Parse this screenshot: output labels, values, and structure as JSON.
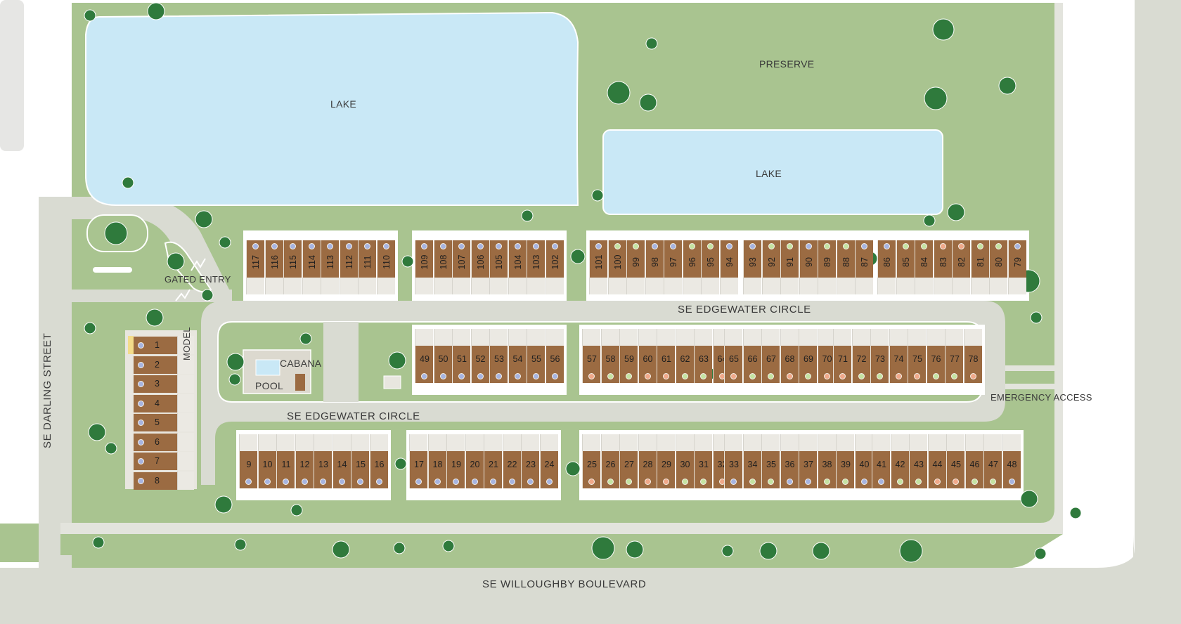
{
  "labels": {
    "lake_1": "LAKE",
    "lake_2": "LAKE",
    "preserve": "PRESERVE",
    "gated_entry": "GATED ENTRY",
    "model": "MODEL",
    "cabana": "CABANA",
    "pool": "POOL",
    "road_edgewater_north": "SE EDGEWATER CIRCLE",
    "road_edgewater_south": "SE EDGEWATER CIRCLE",
    "road_darling": "SE DARLING STREET",
    "road_willoughby": "SE WILLOUGHBY BOULEVARD",
    "emergency_access": "EMERGENCY ACCESS"
  },
  "colors": {
    "grass": "#a9c490",
    "grass_light": "#b7cf9f",
    "water": "#c9e8f6",
    "road": "#d9dbd2",
    "lot": "#9b6b42",
    "tree": "#2f7a3c",
    "dot_blue": "#a7b4e0",
    "dot_green": "#c5e3a2",
    "dot_salmon": "#f0a98a",
    "model_highlight": "#f3dc8a"
  },
  "lot_rows": [
    {
      "id": "row-north-1",
      "orientation": "top",
      "lots": [
        {
          "n": "117",
          "c": "blue"
        },
        {
          "n": "116",
          "c": "blue"
        },
        {
          "n": "115",
          "c": "blue"
        },
        {
          "n": "114",
          "c": "blue"
        },
        {
          "n": "113",
          "c": "blue"
        },
        {
          "n": "112",
          "c": "blue"
        },
        {
          "n": "111",
          "c": "blue"
        },
        {
          "n": "110",
          "c": "blue"
        }
      ]
    },
    {
      "id": "row-north-2",
      "orientation": "top",
      "lots": [
        {
          "n": "109",
          "c": "blue"
        },
        {
          "n": "108",
          "c": "blue"
        },
        {
          "n": "107",
          "c": "blue"
        },
        {
          "n": "106",
          "c": "blue"
        },
        {
          "n": "105",
          "c": "blue"
        },
        {
          "n": "104",
          "c": "blue"
        },
        {
          "n": "103",
          "c": "blue"
        },
        {
          "n": "102",
          "c": "blue"
        }
      ]
    },
    {
      "id": "row-north-3",
      "orientation": "top",
      "lots": [
        {
          "n": "101",
          "c": "blue"
        },
        {
          "n": "100",
          "c": "green"
        },
        {
          "n": "99",
          "c": "green"
        },
        {
          "n": "98",
          "c": "blue"
        },
        {
          "n": "97",
          "c": "blue"
        },
        {
          "n": "96",
          "c": "green"
        },
        {
          "n": "95",
          "c": "green"
        },
        {
          "n": "94",
          "c": "blue"
        }
      ]
    },
    {
      "id": "row-north-4",
      "orientation": "top",
      "lots": [
        {
          "n": "93",
          "c": "blue"
        },
        {
          "n": "92",
          "c": "green"
        },
        {
          "n": "91",
          "c": "green"
        },
        {
          "n": "90",
          "c": "blue"
        },
        {
          "n": "89",
          "c": "green"
        },
        {
          "n": "88",
          "c": "green"
        },
        {
          "n": "87",
          "c": "blue"
        }
      ]
    },
    {
      "id": "row-north-5",
      "orientation": "top",
      "lots": [
        {
          "n": "86",
          "c": "blue"
        },
        {
          "n": "85",
          "c": "green"
        },
        {
          "n": "84",
          "c": "green"
        },
        {
          "n": "83",
          "c": "salmon"
        },
        {
          "n": "82",
          "c": "salmon"
        },
        {
          "n": "81",
          "c": "green"
        },
        {
          "n": "80",
          "c": "green"
        },
        {
          "n": "79",
          "c": "blue"
        }
      ]
    },
    {
      "id": "row-middle-1",
      "orientation": "bot",
      "lots": [
        {
          "n": "49",
          "c": "blue"
        },
        {
          "n": "50",
          "c": "blue"
        },
        {
          "n": "51",
          "c": "blue"
        },
        {
          "n": "52",
          "c": "blue"
        },
        {
          "n": "53",
          "c": "blue"
        },
        {
          "n": "54",
          "c": "blue"
        },
        {
          "n": "55",
          "c": "blue"
        },
        {
          "n": "56",
          "c": "blue"
        }
      ]
    },
    {
      "id": "row-middle-2",
      "orientation": "bot",
      "lots": [
        {
          "n": "57",
          "c": "salmon"
        },
        {
          "n": "58",
          "c": "green"
        },
        {
          "n": "59",
          "c": "green"
        },
        {
          "n": "60",
          "c": "salmon"
        },
        {
          "n": "61",
          "c": "salmon"
        },
        {
          "n": "62",
          "c": "green"
        },
        {
          "n": "63",
          "c": "green"
        },
        {
          "n": "64",
          "c": "salmon"
        }
      ]
    },
    {
      "id": "row-middle-3",
      "orientation": "bot",
      "lots": [
        {
          "n": "65",
          "c": "salmon"
        },
        {
          "n": "66",
          "c": "green"
        },
        {
          "n": "67",
          "c": "green"
        },
        {
          "n": "68",
          "c": "salmon"
        },
        {
          "n": "69",
          "c": "green"
        },
        {
          "n": "70",
          "c": "salmon"
        }
      ]
    },
    {
      "id": "row-middle-4",
      "orientation": "bot",
      "lots": [
        {
          "n": "71",
          "c": "salmon"
        },
        {
          "n": "72",
          "c": "green"
        },
        {
          "n": "73",
          "c": "green"
        },
        {
          "n": "74",
          "c": "salmon"
        },
        {
          "n": "75",
          "c": "salmon"
        },
        {
          "n": "76",
          "c": "green"
        },
        {
          "n": "77",
          "c": "green"
        },
        {
          "n": "78",
          "c": "salmon"
        }
      ]
    },
    {
      "id": "row-south-1",
      "orientation": "bot",
      "lots": [
        {
          "n": "9",
          "c": "blue"
        },
        {
          "n": "10",
          "c": "blue"
        },
        {
          "n": "11",
          "c": "blue"
        },
        {
          "n": "12",
          "c": "blue"
        },
        {
          "n": "13",
          "c": "blue"
        },
        {
          "n": "14",
          "c": "blue"
        },
        {
          "n": "15",
          "c": "blue"
        },
        {
          "n": "16",
          "c": "blue"
        }
      ]
    },
    {
      "id": "row-south-2",
      "orientation": "bot",
      "lots": [
        {
          "n": "17",
          "c": "blue"
        },
        {
          "n": "18",
          "c": "blue"
        },
        {
          "n": "19",
          "c": "blue"
        },
        {
          "n": "20",
          "c": "blue"
        },
        {
          "n": "21",
          "c": "blue"
        },
        {
          "n": "22",
          "c": "blue"
        },
        {
          "n": "23",
          "c": "blue"
        },
        {
          "n": "24",
          "c": "blue"
        }
      ]
    },
    {
      "id": "row-south-3",
      "orientation": "bot",
      "lots": [
        {
          "n": "25",
          "c": "salmon"
        },
        {
          "n": "26",
          "c": "green"
        },
        {
          "n": "27",
          "c": "green"
        },
        {
          "n": "28",
          "c": "salmon"
        },
        {
          "n": "29",
          "c": "salmon"
        },
        {
          "n": "30",
          "c": "green"
        },
        {
          "n": "31",
          "c": "green"
        },
        {
          "n": "32",
          "c": "salmon"
        }
      ]
    },
    {
      "id": "row-south-4",
      "orientation": "bot",
      "lots": [
        {
          "n": "33",
          "c": "blue"
        },
        {
          "n": "34",
          "c": "green"
        },
        {
          "n": "35",
          "c": "green"
        },
        {
          "n": "36",
          "c": "blue"
        },
        {
          "n": "37",
          "c": "blue"
        },
        {
          "n": "38",
          "c": "green"
        },
        {
          "n": "39",
          "c": "green"
        },
        {
          "n": "40",
          "c": "blue"
        }
      ]
    },
    {
      "id": "row-south-5",
      "orientation": "bot",
      "lots": [
        {
          "n": "41",
          "c": "blue"
        },
        {
          "n": "42",
          "c": "green"
        },
        {
          "n": "43",
          "c": "green"
        },
        {
          "n": "44",
          "c": "salmon"
        },
        {
          "n": "45",
          "c": "salmon"
        },
        {
          "n": "46",
          "c": "green"
        },
        {
          "n": "47",
          "c": "green"
        },
        {
          "n": "48",
          "c": "blue"
        }
      ]
    }
  ],
  "west_lots": [
    {
      "n": "1",
      "c": "blue"
    },
    {
      "n": "2",
      "c": "blue"
    },
    {
      "n": "3",
      "c": "blue"
    },
    {
      "n": "4",
      "c": "blue"
    },
    {
      "n": "5",
      "c": "blue"
    },
    {
      "n": "6",
      "c": "blue"
    },
    {
      "n": "7",
      "c": "blue"
    },
    {
      "n": "8",
      "c": "blue"
    }
  ]
}
